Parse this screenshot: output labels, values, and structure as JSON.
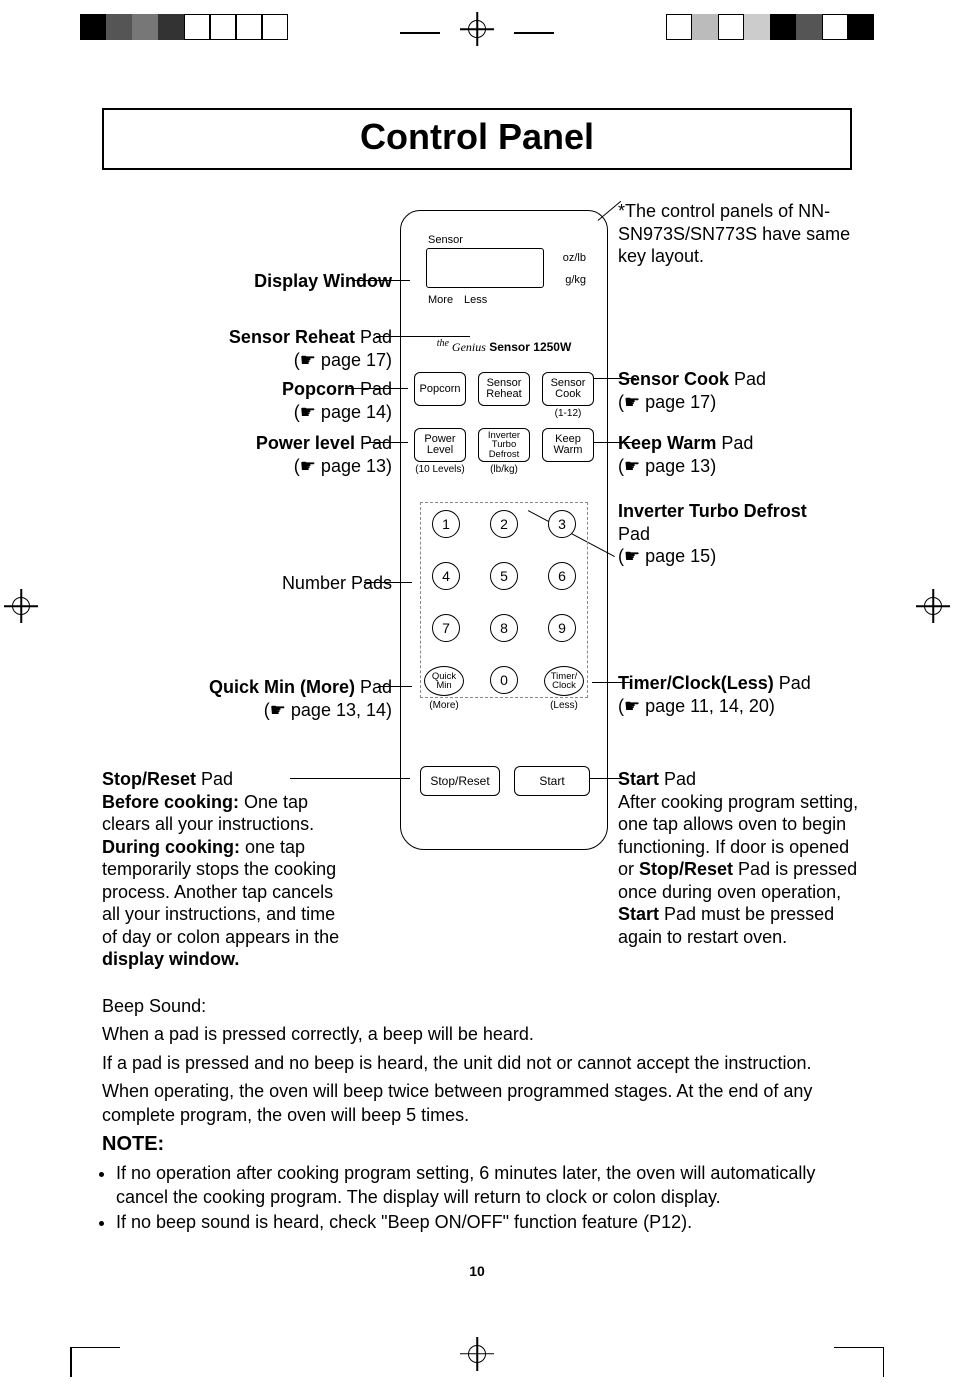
{
  "title": "Control Panel",
  "page_number": "10",
  "top_note": "*The control panels of NN-SN973S/SN773S have same key layout.",
  "left_labels": {
    "display_window": "Display Window",
    "sensor_reheat": {
      "bold": "Sensor Reheat",
      "rest": " Pad",
      "page": "(☛ page 17)"
    },
    "popcorn": {
      "bold": "Popcorn",
      "rest": " Pad",
      "page": "(☛ page 14)"
    },
    "power_level": {
      "bold": "Power level",
      "rest": " Pad",
      "page": "(☛ page 13)"
    },
    "number_pads": "Number Pads",
    "quick_min": {
      "bold": "Quick Min (More)",
      "rest": " Pad",
      "page": "(☛ page 13, 14)"
    },
    "stop_reset": {
      "title_bold": "Stop/Reset",
      "title_rest": " Pad",
      "before_bold": "Before cooking:",
      "before_rest": " One tap clears all your instructions.",
      "during_bold": "During cooking:",
      "during_rest": " one tap temporarily stops the cooking process. Another tap cancels all your instructions, and time of day or colon appears in the ",
      "end_bold": "display window."
    }
  },
  "right_labels": {
    "sensor_cook": {
      "bold": "Sensor Cook",
      "rest": " Pad",
      "page": "(☛ page 17)"
    },
    "keep_warm": {
      "bold": "Keep Warm",
      "rest": " Pad",
      "page": "(☛ page 13)"
    },
    "inverter": {
      "bold": "Inverter Turbo Defrost",
      "rest2": "Pad",
      "page": "(☛ page 15)"
    },
    "timer_clock": {
      "bold": "Timer/Clock(Less)",
      "rest": " Pad",
      "page": "(☛ page 11, 14, 20)"
    },
    "start": {
      "title_bold": "Start",
      "title_rest": " Pad",
      "body1": "After cooking program setting, one tap allows oven to begin functioning. If door is opened or ",
      "mid_bold": "Stop/Reset",
      "body2": " Pad is pressed once during oven operation, ",
      "mid_bold2": "Start",
      "body3": " Pad must be pressed again to restart oven."
    }
  },
  "panel": {
    "sensor": "Sensor",
    "unit1": "oz/lb",
    "unit2": "g/kg",
    "more": "More",
    "less": "Less",
    "brand_script": "Genius",
    "brand_prefix": "the",
    "brand_bold": "Sensor 1250W",
    "popcorn": "Popcorn",
    "sensor_reheat_l1": "Sensor",
    "sensor_reheat_l2": "Reheat",
    "sensor_cook_l1": "Sensor",
    "sensor_cook_l2": "Cook",
    "sub_112": "(1-12)",
    "power_l1": "Power",
    "power_l2": "Level",
    "sub_10": "(10 Levels)",
    "inverter_l1": "Inverter",
    "inverter_l2": "Turbo",
    "inverter_l3": "Defrost",
    "sub_lbkg": "(lb/kg)",
    "keep_l1": "Keep",
    "keep_l2": "Warm",
    "n1": "1",
    "n2": "2",
    "n3": "3",
    "n4": "4",
    "n5": "5",
    "n6": "6",
    "n7": "7",
    "n8": "8",
    "n9": "9",
    "n0": "0",
    "quick_l1": "Quick",
    "quick_l2": "Min",
    "quick_sub": "(More)",
    "timer_l1": "Timer/",
    "timer_l2": "Clock",
    "timer_sub": "(Less)",
    "stop": "Stop/Reset",
    "start": "Start"
  },
  "beep": {
    "heading": "Beep Sound:",
    "p1": "When a pad is pressed correctly, a beep will be heard.",
    "p2": "If a pad is pressed and no beep is heard, the unit did not or cannot accept the instruction.",
    "p3": "When operating, the oven will beep twice between programmed stages. At the end of any complete program, the oven will beep 5 times."
  },
  "note": {
    "heading": "NOTE:",
    "b1": "If no operation after cooking program setting, 6 minutes later, the oven will automatically cancel the cooking program. The display will return to clock or colon display.",
    "b2": "If no beep sound is heard, check \"Beep ON/OFF\" function feature (P12)."
  }
}
